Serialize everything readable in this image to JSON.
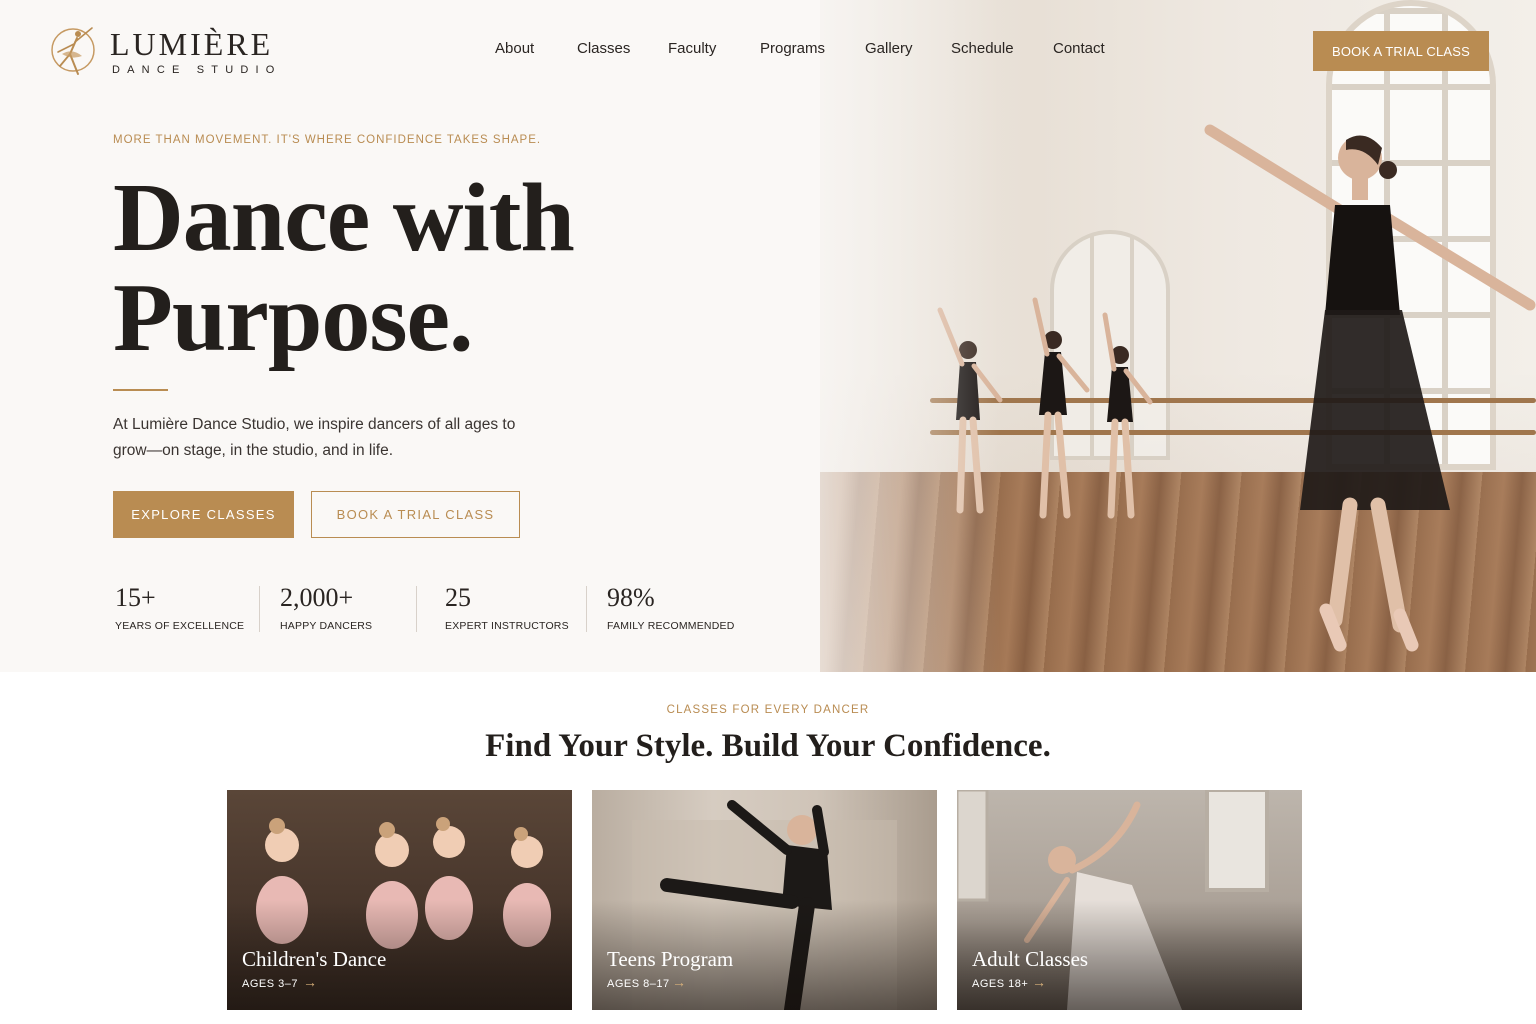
{
  "brand": {
    "name": "LUMIÈRE",
    "tagline": "DANCE STUDIO",
    "accent_color": "#b98c52"
  },
  "nav": {
    "items": [
      "About",
      "Classes",
      "Faculty",
      "Programs",
      "Gallery",
      "Schedule",
      "Contact"
    ],
    "cta": "BOOK A TRIAL CLASS"
  },
  "hero": {
    "eyebrow": "MORE THAN MOVEMENT. IT'S WHERE CONFIDENCE TAKES SHAPE.",
    "headline_line1": "Dance with",
    "headline_line2": "Purpose.",
    "intro": "At Lumière Dance Studio, we inspire dancers of all ages to grow—on stage, in the studio, and in life.",
    "primary_button": "EXPLORE CLASSES",
    "secondary_button": "BOOK A TRIAL CLASS",
    "stats": [
      {
        "value": "15+",
        "label": "YEARS OF EXCELLENCE"
      },
      {
        "value": "2,000+",
        "label": "HAPPY DANCERS"
      },
      {
        "value": "25",
        "label": "EXPERT INSTRUCTORS"
      },
      {
        "value": "98%",
        "label": "FAMILY RECOMMENDED"
      }
    ]
  },
  "classes": {
    "eyebrow": "CLASSES FOR EVERY DANCER",
    "title": "Find Your Style. Build Your Confidence.",
    "cards": [
      {
        "title": "Children's Dance",
        "ages": "AGES 3–7",
        "icon": "arrow-right-icon"
      },
      {
        "title": "Teens Program",
        "ages": "AGES 8–17",
        "icon": "arrow-right-icon"
      },
      {
        "title": "Adult Classes",
        "ages": "AGES 18+",
        "icon": "arrow-right-icon"
      }
    ]
  }
}
